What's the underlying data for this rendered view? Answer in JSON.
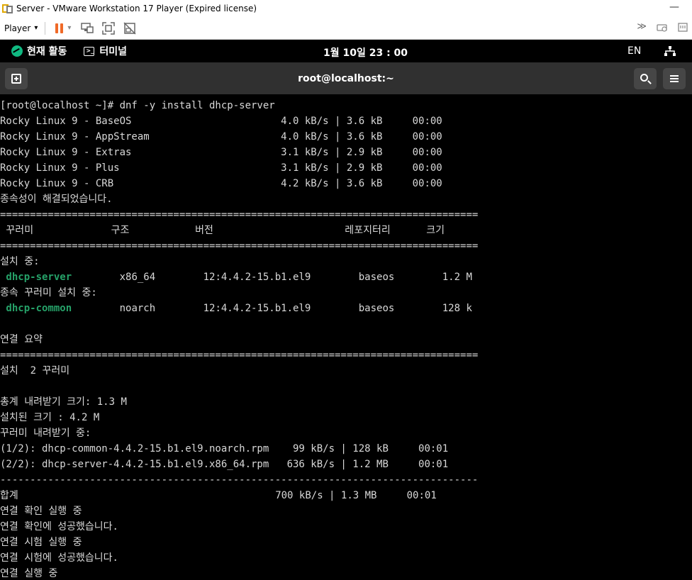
{
  "window": {
    "title": "Server - VMware Workstation 17 Player (Expired license)",
    "minimize_glyph": "—"
  },
  "toolbar": {
    "player_label": "Player",
    "player_dropdown": "▾",
    "pause_dropdown": "▾"
  },
  "gnome": {
    "activities": "현재 활동",
    "app_name": "터미널",
    "clock": "1월 10일  23 : 00",
    "lang": "EN"
  },
  "terminal": {
    "title": "root@localhost:~",
    "accent_color": "#26a269",
    "lines": [
      "[root@localhost ~]# dnf -y install dhcp-server",
      "Rocky Linux 9 - BaseOS                         4.0 kB/s | 3.6 kB     00:00",
      "Rocky Linux 9 - AppStream                      4.0 kB/s | 3.6 kB     00:00",
      "Rocky Linux 9 - Extras                         3.1 kB/s | 2.9 kB     00:00",
      "Rocky Linux 9 - Plus                           3.1 kB/s | 2.9 kB     00:00",
      "Rocky Linux 9 - CRB                            4.2 kB/s | 3.6 kB     00:00",
      "종속성이 해결되었습니다.",
      "================================================================================",
      " 꾸러미             구조           버전                      레포지터리      크기",
      "================================================================================",
      "설치 중:",
      {
        "pkg": " dhcp-server",
        "rest": "        x86_64        12:4.4.2-15.b1.el9        baseos        1.2 M"
      },
      "종속 꾸러미 설치 중:",
      {
        "pkg": " dhcp-common",
        "rest": "        noarch        12:4.4.2-15.b1.el9        baseos        128 k"
      },
      "",
      "연결 요약",
      "================================================================================",
      "설치  2 꾸러미",
      "",
      "총계 내려받기 크기: 1.3 M",
      "설치된 크기 : 4.2 M",
      "꾸러미 내려받기 중:",
      "(1/2): dhcp-common-4.4.2-15.b1.el9.noarch.rpm    99 kB/s | 128 kB     00:01",
      "(2/2): dhcp-server-4.4.2-15.b1.el9.x86_64.rpm   636 kB/s | 1.2 MB     00:01",
      "--------------------------------------------------------------------------------",
      "합계                                           700 kB/s | 1.3 MB     00:01",
      "연결 확인 실행 중",
      "연결 확인에 성공했습니다.",
      "연결 시험 실행 중",
      "연결 시험에 성공했습니다.",
      "연결 실행 중"
    ]
  }
}
